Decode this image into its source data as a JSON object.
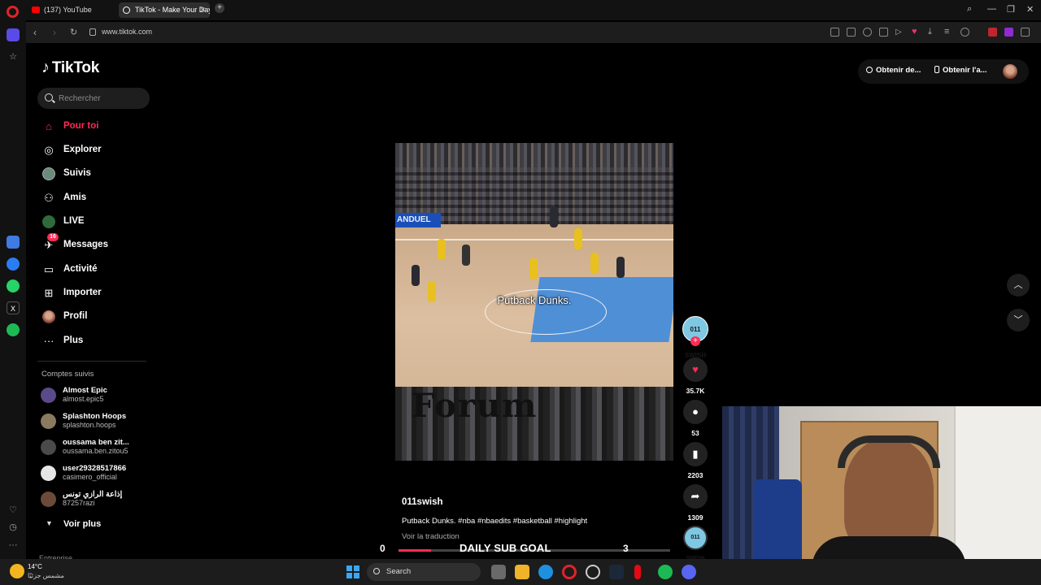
{
  "browser": {
    "tabs": [
      {
        "label": "(137) YouTube"
      },
      {
        "label": "TikTok - Make Your Day"
      }
    ],
    "url": "www.tiktok.com"
  },
  "tiktok": {
    "logo": "TikTok",
    "search_placeholder": "Rechercher",
    "nav": [
      {
        "label": "Pour toi",
        "icon": "home-icon",
        "active": true
      },
      {
        "label": "Explorer",
        "icon": "compass-icon"
      },
      {
        "label": "Suivis",
        "icon": "following-avatar-icon"
      },
      {
        "label": "Amis",
        "icon": "friends-icon"
      },
      {
        "label": "LIVE",
        "icon": "live-icon"
      },
      {
        "label": "Messages",
        "icon": "messages-icon",
        "badge": "16"
      },
      {
        "label": "Activité",
        "icon": "activity-icon"
      },
      {
        "label": "Importer",
        "icon": "upload-icon"
      },
      {
        "label": "Profil",
        "icon": "profile-icon"
      },
      {
        "label": "Plus",
        "icon": "more-icon"
      }
    ],
    "following_title": "Comptes suivis",
    "following": [
      {
        "name": "Almost Epic",
        "user": "almost.epic5"
      },
      {
        "name": "Splashton Hoops",
        "user": "splashton.hoops"
      },
      {
        "name": "oussama ben zit...",
        "user": "oussama.ben.zitou5"
      },
      {
        "name": "user29328517866",
        "user": "casimero_official"
      },
      {
        "name": "إذاعة الرازي تونس",
        "user": "87257razi"
      }
    ],
    "see_more": "Voir plus",
    "footer_section": "Entreprise",
    "top_right": {
      "coins_label": "Obtenir de...",
      "app_label": "Obtenir l'a..."
    }
  },
  "video": {
    "caption_overlay": "Putback Dunks.",
    "banner_text": "ANDUEL",
    "arena_text": "Forum",
    "author": "011swish",
    "description": "Putback Dunks. #nba #nbaedits #basketball #highlight",
    "translate": "Voir la traduction",
    "creator_badge": "011 SWISH",
    "likes": "35.7K",
    "comments": "53",
    "saves": "2203",
    "shares": "1309"
  },
  "sub_goal": {
    "title": "DAILY SUB GOAL",
    "start": "0",
    "end": "3",
    "progress": 0.12
  },
  "taskbar": {
    "temperature": "14°C",
    "weather_desc": "مشمس جزئيًا",
    "search_label": "Search"
  },
  "colors": {
    "accent": "#fe2c55",
    "background": "#000000"
  }
}
